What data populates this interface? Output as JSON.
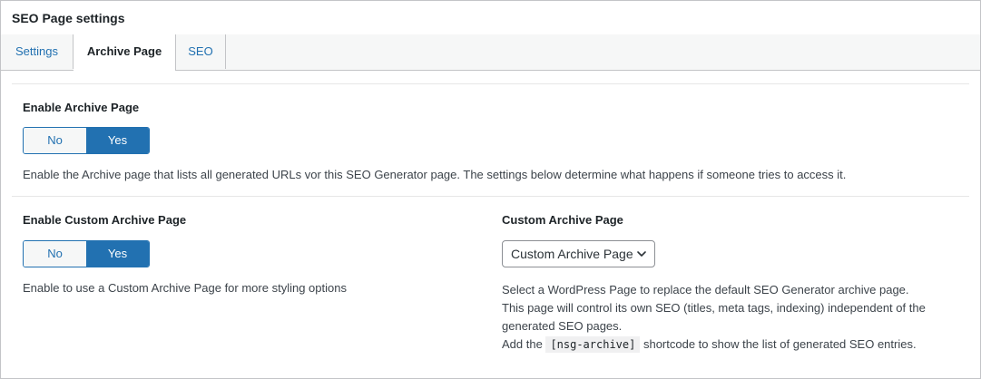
{
  "panel": {
    "title": "SEO Page settings"
  },
  "tabs": [
    {
      "label": "Settings"
    },
    {
      "label": "Archive Page"
    },
    {
      "label": "SEO"
    }
  ],
  "enable_archive": {
    "label": "Enable Archive Page",
    "no_label": "No",
    "yes_label": "Yes",
    "selected": "Yes",
    "description": "Enable the Archive page that lists all generated URLs vor this SEO Generator page. The settings below determine what happens if someone tries to access it."
  },
  "enable_custom_archive": {
    "label": "Enable Custom Archive Page",
    "no_label": "No",
    "yes_label": "Yes",
    "selected": "Yes",
    "description": "Enable to use a Custom Archive Page for more styling options"
  },
  "custom_archive_page": {
    "label": "Custom Archive Page",
    "selected_value": "Custom Archive Page",
    "desc_line1": "Select a WordPress Page to replace the default SEO Generator archive page.",
    "desc_line2": "This page will control its own SEO (titles, meta tags, indexing) independent of the",
    "desc_line3": "generated SEO pages.",
    "desc_line4_pre": "Add the ",
    "desc_line4_code": "[nsg-archive]",
    "desc_line4_post": " shortcode to show the list of generated SEO entries."
  },
  "colors": {
    "accent": "#2271b1",
    "border": "#c3c4c7",
    "tab_bg": "#f6f7f7"
  }
}
